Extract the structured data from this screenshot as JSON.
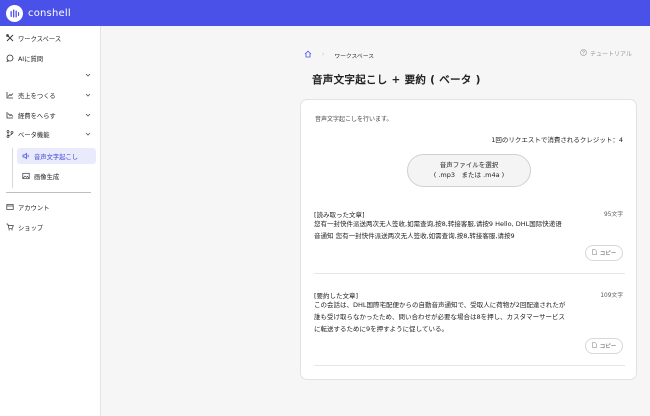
{
  "app": {
    "name": "conshell"
  },
  "sidebar": {
    "items": [
      {
        "label": "ワークスペース",
        "icon": "tools-icon"
      },
      {
        "label": "AIに質問",
        "icon": "chat-icon"
      },
      {
        "label": "",
        "icon": ""
      },
      {
        "label": "売上をつくる",
        "icon": "chart-up-icon"
      },
      {
        "label": "経費をへらす",
        "icon": "chart-down-icon"
      },
      {
        "label": "ベータ機能",
        "icon": "branch-icon"
      }
    ],
    "sub_items": [
      {
        "label": "音声文字起こし",
        "icon": "speaker-icon",
        "active": true
      },
      {
        "label": "画像生成",
        "icon": "image-icon",
        "active": false
      }
    ],
    "bottom_items": [
      {
        "label": "アカウント",
        "icon": "account-icon"
      },
      {
        "label": "ショップ",
        "icon": "cart-icon"
      }
    ]
  },
  "breadcrumb": {
    "current": "ワークスペース"
  },
  "tutorial_label": "チュートリアル",
  "page_title": "音声文字起こし + 要約 ( ベータ )",
  "card": {
    "description": "音声文字起こしを行います。",
    "credit_text": "1回のリクエストで消費されるクレジット：4",
    "upload": {
      "line1": "音声ファイルを選択",
      "line2": "( .mp3　または .m4a )"
    },
    "transcript": {
      "label": "[読み取った文章]",
      "count": "95文字",
      "lines": [
        "您有一封快件派送两次无人签收,如需查询,按8,转接客服,请按9 Hello, DHL国际快递语",
        "音通知 您有一封快件派送两次无人签收,如需查询,按8,转接客服,请按9"
      ],
      "copy_label": "コピー"
    },
    "summary": {
      "label": "[要約した文章]",
      "count": "109文字",
      "lines": [
        "この会話は、DHL国際宅配便からの自動音声通知で、受取人に荷物が2回配達されたが",
        "誰も受け取らなかったため、問い合わせが必要な場合は8を押し、カスタマーサービス",
        "に転送するために9を押すように促している。"
      ],
      "copy_label": "コピー"
    }
  },
  "colors": {
    "accent": "#4a51e8",
    "active_bg": "#e9eafc",
    "active_text": "#3b42d6"
  }
}
